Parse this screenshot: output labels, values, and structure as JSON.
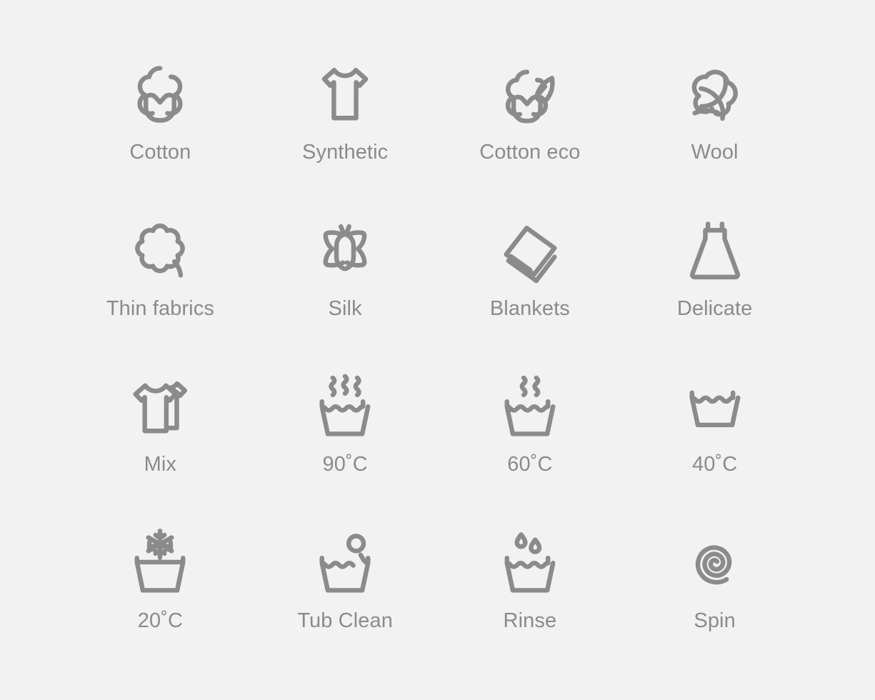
{
  "palette": {
    "background": "#f2f2f2",
    "icon_stroke": "#8b8b8b",
    "label_text": "#8b8b8b"
  },
  "grid": {
    "columns": 4,
    "rows": 4
  },
  "icons": [
    {
      "label": "Cotton",
      "icon": "cotton-boll-icon"
    },
    {
      "label": "Synthetic",
      "icon": "tshirt-icon"
    },
    {
      "label": "Cotton eco",
      "icon": "cotton-boll-leaf-icon"
    },
    {
      "label": "Wool",
      "icon": "yarn-ball-icon"
    },
    {
      "label": "Thin fabrics",
      "icon": "scalloped-flower-icon"
    },
    {
      "label": "Silk",
      "icon": "butterfly-icon"
    },
    {
      "label": "Blankets",
      "icon": "folded-blanket-icon"
    },
    {
      "label": "Delicate",
      "icon": "dress-icon"
    },
    {
      "label": "Mix",
      "icon": "two-tshirts-icon"
    },
    {
      "label": "90˚C",
      "icon": "wash-tub-three-steam-icon"
    },
    {
      "label": "60˚C",
      "icon": "wash-tub-two-steam-icon"
    },
    {
      "label": "40˚C",
      "icon": "wash-tub-icon"
    },
    {
      "label": "20˚C",
      "icon": "wash-tub-snowflake-icon"
    },
    {
      "label": "Tub Clean",
      "icon": "wash-tub-bubble-icon"
    },
    {
      "label": "Rinse",
      "icon": "wash-tub-droplets-icon"
    },
    {
      "label": "Spin",
      "icon": "spiral-icon"
    }
  ]
}
